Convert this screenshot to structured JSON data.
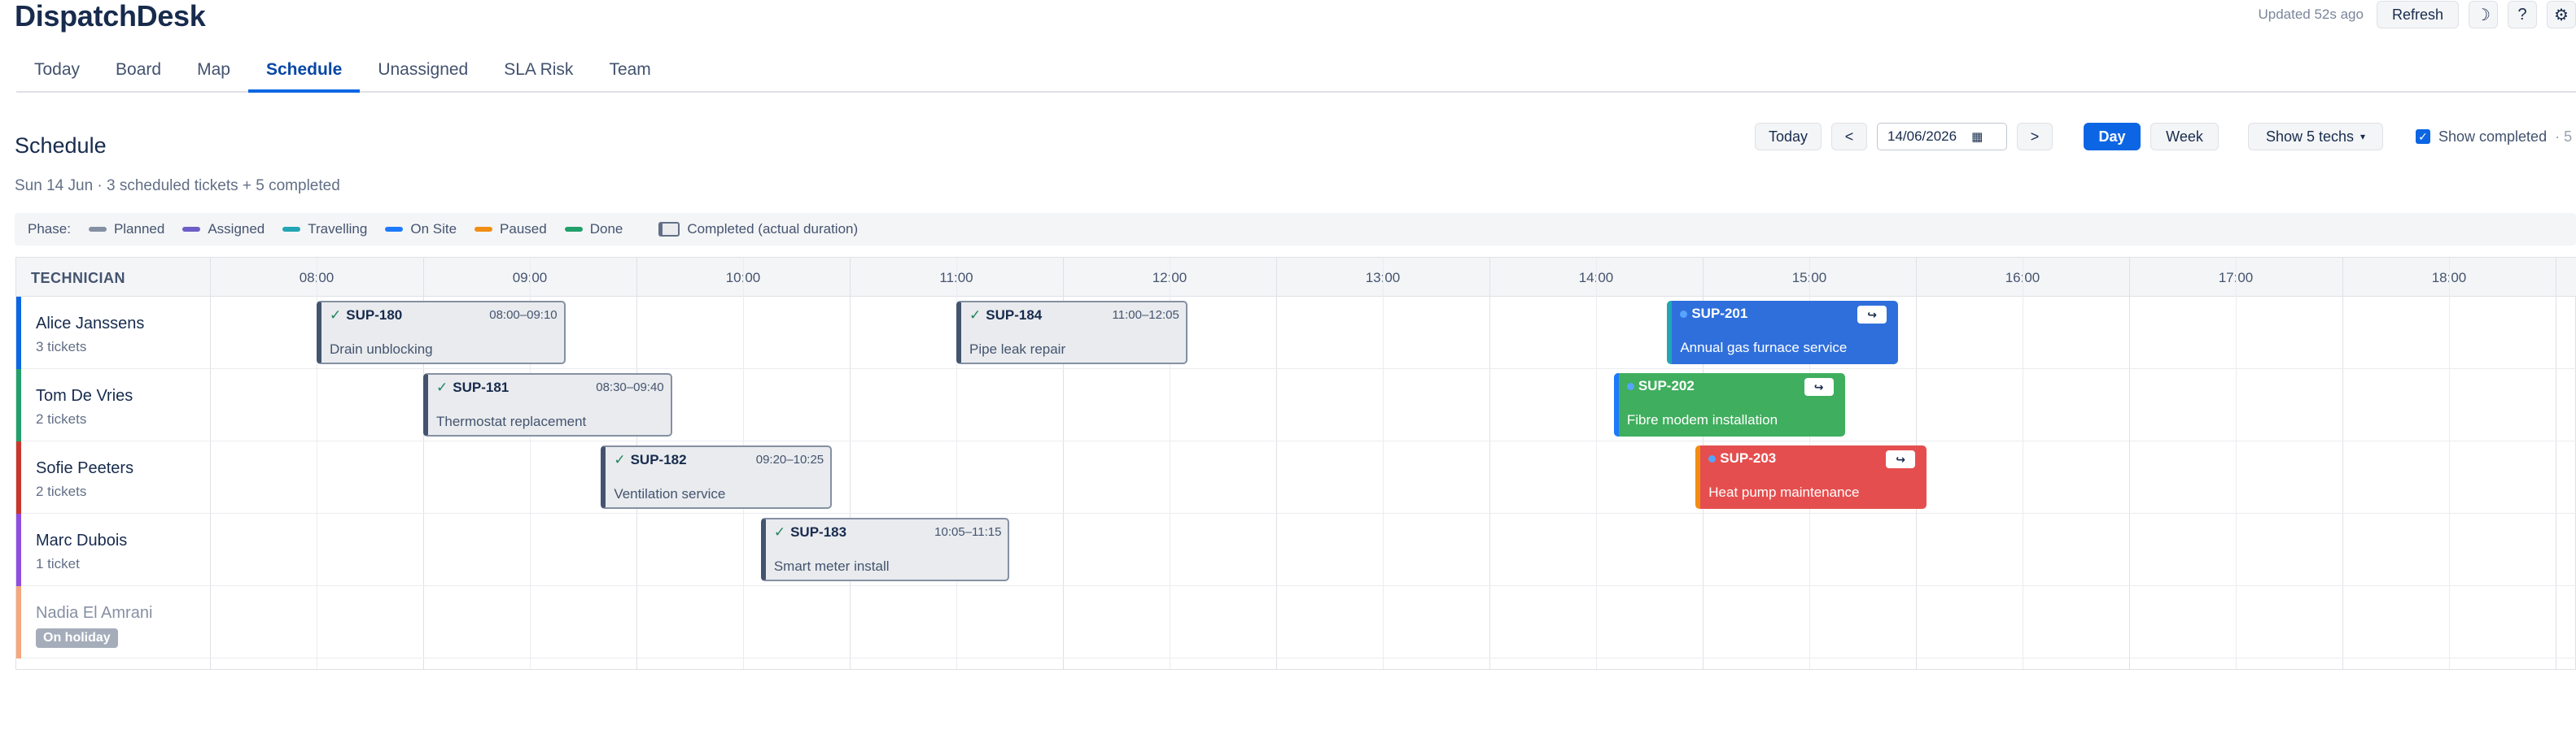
{
  "app": {
    "title": "DispatchDesk",
    "updated": "Updated 52s ago",
    "refresh_label": "Refresh",
    "theme_icon": "moon-icon",
    "help_label": "?",
    "settings_icon": "gear-icon"
  },
  "tabs": [
    {
      "label": "Today"
    },
    {
      "label": "Board"
    },
    {
      "label": "Map"
    },
    {
      "label": "Schedule",
      "active": true
    },
    {
      "label": "Unassigned"
    },
    {
      "label": "SLA Risk"
    },
    {
      "label": "Team"
    }
  ],
  "schedule": {
    "title": "Schedule",
    "subtitle": "Sun 14 Jun · 3 scheduled tickets + 5 completed"
  },
  "controls": {
    "today_label": "Today",
    "prev_label": "<",
    "next_label": ">",
    "date_value": "14/06/2026",
    "day_label": "Day",
    "week_label": "Week",
    "techs_label": "Show 5 techs",
    "techs_caret": "▾",
    "show_completed_label": "Show completed",
    "show_completed_suffix": "· 5"
  },
  "legend": {
    "label": "Phase:",
    "items": [
      {
        "label": "Planned",
        "color": "#8590a2"
      },
      {
        "label": "Assigned",
        "color": "#6e5dc6"
      },
      {
        "label": "Travelling",
        "color": "#22a6b3"
      },
      {
        "label": "On Site",
        "color": "#1d7afc"
      },
      {
        "label": "Paused",
        "color": "#f18d13"
      },
      {
        "label": "Done",
        "color": "#22a06b"
      }
    ],
    "completed_label": "Completed (actual duration)"
  },
  "grid": {
    "technician_header": "TECHNICIAN",
    "hours": [
      "08:00",
      "09:00",
      "10:00",
      "11:00",
      "12:00",
      "13:00",
      "14:00",
      "15:00",
      "16:00",
      "17:00",
      "18:00"
    ]
  },
  "technicians": [
    {
      "name": "Alice Janssens",
      "count": "3 tickets",
      "color": "#0c66e4"
    },
    {
      "name": "Tom De Vries",
      "count": "2 tickets",
      "color": "#22a06b"
    },
    {
      "name": "Sofie Peeters",
      "count": "2 tickets",
      "color": "#c9372c"
    },
    {
      "name": "Marc Dubois",
      "count": "1 ticket",
      "color": "#8f4ee0"
    },
    {
      "name": "Nadia El Amrani",
      "badge": "On holiday",
      "color": "#f5a77d"
    }
  ],
  "tickets": [
    {
      "tech": 0,
      "id": "SUP-180",
      "title": "Drain unblocking",
      "start": "08:00",
      "end": "09:10",
      "status": "completed",
      "time_label": "08:00–09:10"
    },
    {
      "tech": 0,
      "id": "SUP-184",
      "title": "Pipe leak repair",
      "start": "11:00",
      "end": "12:05",
      "status": "completed",
      "time_label": "11:00–12:05"
    },
    {
      "tech": 0,
      "id": "SUP-201",
      "title": "Annual gas furnace service",
      "start": "14:20",
      "end": "15:25",
      "status": "active",
      "phase": "Travelling",
      "bg": "#2f6fdb",
      "stripe": "#22a6b3",
      "reassign": "↪"
    },
    {
      "tech": 1,
      "id": "SUP-181",
      "title": "Thermostat replacement",
      "start": "08:30",
      "end": "09:40",
      "status": "completed",
      "time_label": "08:30–09:40"
    },
    {
      "tech": 1,
      "id": "SUP-202",
      "title": "Fibre modem installation",
      "start": "14:05",
      "end": "15:10",
      "status": "active",
      "phase": "On Site",
      "bg": "#3fae5e",
      "stripe": "#1d7afc",
      "reassign": "↪"
    },
    {
      "tech": 2,
      "id": "SUP-182",
      "title": "Ventilation service",
      "start": "09:20",
      "end": "10:25",
      "status": "completed",
      "time_label": "09:20–10:25"
    },
    {
      "tech": 2,
      "id": "SUP-203",
      "title": "Heat pump maintenance",
      "start": "14:28",
      "end": "15:33",
      "status": "active",
      "phase": "Paused",
      "bg": "#e54e4e",
      "stripe": "#f18d13",
      "reassign": "↪"
    },
    {
      "tech": 3,
      "id": "SUP-183",
      "title": "Smart meter install",
      "start": "10:05",
      "end": "11:15",
      "status": "completed",
      "time_label": "10:05–11:15"
    }
  ]
}
